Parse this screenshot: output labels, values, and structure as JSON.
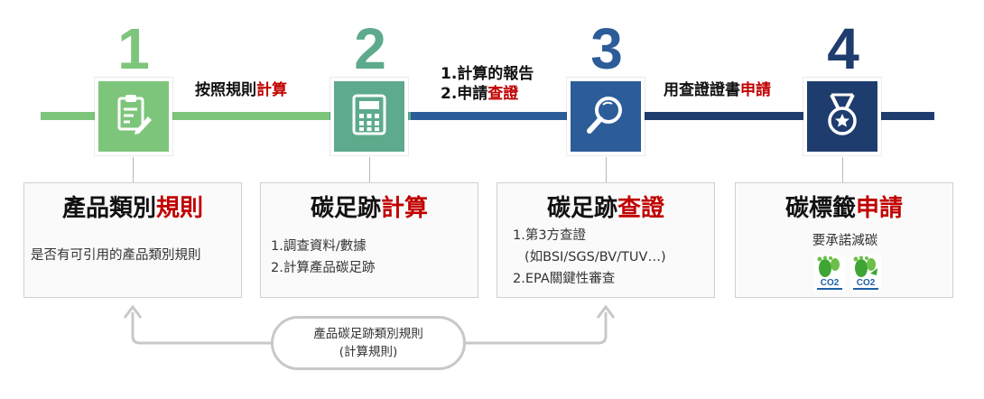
{
  "steps": [
    {
      "number": "1",
      "color": "#7dc57b",
      "icon": "clipboard-pen-icon",
      "card": {
        "title_black": "產品類別",
        "title_red": "規則",
        "lines": [
          "是否有可引用的產品類別規則"
        ]
      }
    },
    {
      "number": "2",
      "color": "#5dab8c",
      "icon": "calculator-icon",
      "card": {
        "title_black": "碳足跡",
        "title_red": "計算",
        "lines": [
          "1.調查資料/數據",
          "2.計算產品碳足跡"
        ]
      }
    },
    {
      "number": "3",
      "color": "#2c5d98",
      "icon": "magnifier-icon",
      "card": {
        "title_black": "碳足跡",
        "title_red": "查證",
        "lines": [
          "1.第3方查證",
          "(如BSI/SGS/BV/TUV…)",
          "2.EPA關鍵性審查"
        ]
      }
    },
    {
      "number": "4",
      "color": "#1f3c6e",
      "icon": "medal-icon",
      "card": {
        "title_black": "碳標籤",
        "title_red": "申請",
        "lines": [
          "要承諾減碳"
        ],
        "label_icons": [
          "carbon-footprint-label-icon",
          "carbon-footprint-reduction-label-icon"
        ],
        "label_text": "CO2"
      }
    }
  ],
  "segments": {
    "s12": {
      "black": "按照規則",
      "red": "計算"
    },
    "s23": {
      "line1": "1.計算的報告",
      "line2_black": "2.申請",
      "line2_red": "查證"
    },
    "s34": {
      "black": "用查證證書",
      "red": "申請"
    }
  },
  "footer": {
    "line1": "產品碳足跡類別規則",
    "line2": "(計算規則)"
  },
  "colors": {
    "accent_red": "#c00000",
    "light_green": "#7dc57b",
    "mid_green": "#5dab8c",
    "blue": "#2c5d98",
    "navy": "#1f3c6e"
  }
}
